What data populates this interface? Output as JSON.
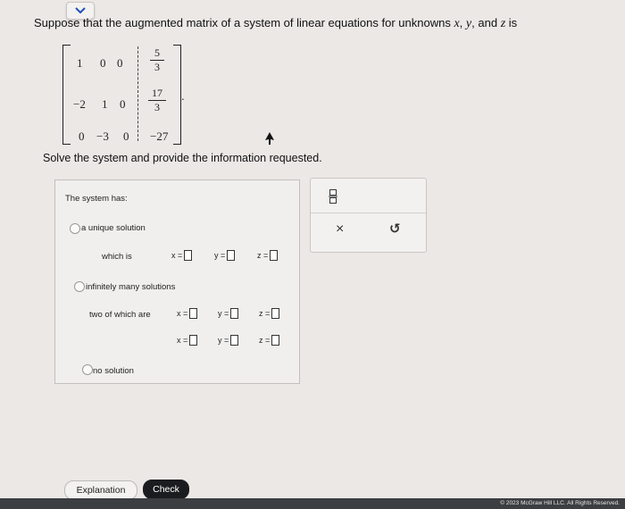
{
  "question": {
    "prefix": "Suppose that the augmented matrix of a system of linear equations for unknowns",
    "var_x": "x",
    "var_y": "y",
    "var_z": "z",
    "and": "and",
    "suffix": "is"
  },
  "matrix": {
    "row1": [
      "1",
      "0",
      "0"
    ],
    "row1_rhs": {
      "num": "5",
      "den": "3"
    },
    "row2": [
      "−2",
      "1",
      "0"
    ],
    "row2_rhs": {
      "num": "17",
      "den": "3"
    },
    "row3": [
      "0",
      "−3",
      "0"
    ],
    "row3_rhs": "−27",
    "period": "."
  },
  "instructions": "Solve the system and provide the information requested.",
  "answer_panel": {
    "heading": "The system has:",
    "options": {
      "unique": {
        "label": "a unique solution",
        "which_is": "which is"
      },
      "infinite": {
        "label": "infinitely many solutions",
        "two_of_which": "two of which are"
      },
      "none": {
        "label": "no solution"
      }
    },
    "eq_x": "x =",
    "eq_y": "y =",
    "eq_z": "z ="
  },
  "tools": {
    "fraction_icon": "fraction-icon",
    "clear_icon": "×",
    "undo_icon": "↺"
  },
  "buttons": {
    "explanation": "Explanation",
    "check": "Check"
  },
  "footer": {
    "copyright": "© 2023 McGraw Hill LLC. All Rights Reserved."
  }
}
